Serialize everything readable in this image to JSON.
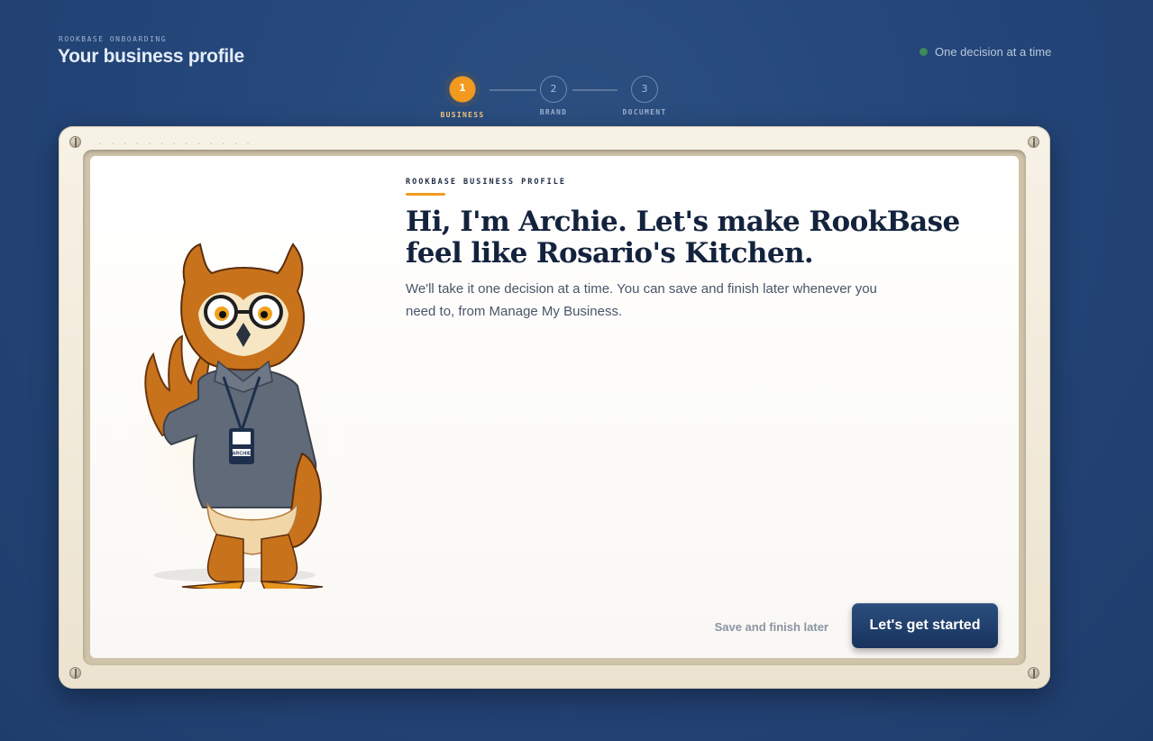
{
  "header": {
    "eyebrow": "ROOKBASE ONBOARDING",
    "title": "Your business profile",
    "status_text": "One decision at a time",
    "status_color": "#3f8a57"
  },
  "stepper": {
    "steps": [
      {
        "number": "1",
        "label": "BUSINESS",
        "state": "active"
      },
      {
        "number": "2",
        "label": "BRAND",
        "state": "upcoming"
      },
      {
        "number": "3",
        "label": "DOCUMENT",
        "state": "upcoming"
      }
    ],
    "accent_color": "#f29a1f"
  },
  "card": {
    "vent_text": "· · · · · · · · · · · · ·",
    "kicker": "ROOKBASE BUSINESS PROFILE",
    "headline": "Hi, I'm Archie. Let's make RookBase feel like Rosario's Kitchen.",
    "subtext": "We'll take it one decision at a time. You can save and finish later whenever you need to, from Manage My Business.",
    "badge_text": "ARCHIE",
    "mascot_icon": "owl-mascot-icon"
  },
  "actions": {
    "save_label": "Save and finish later",
    "primary_label": "Let's get started"
  }
}
